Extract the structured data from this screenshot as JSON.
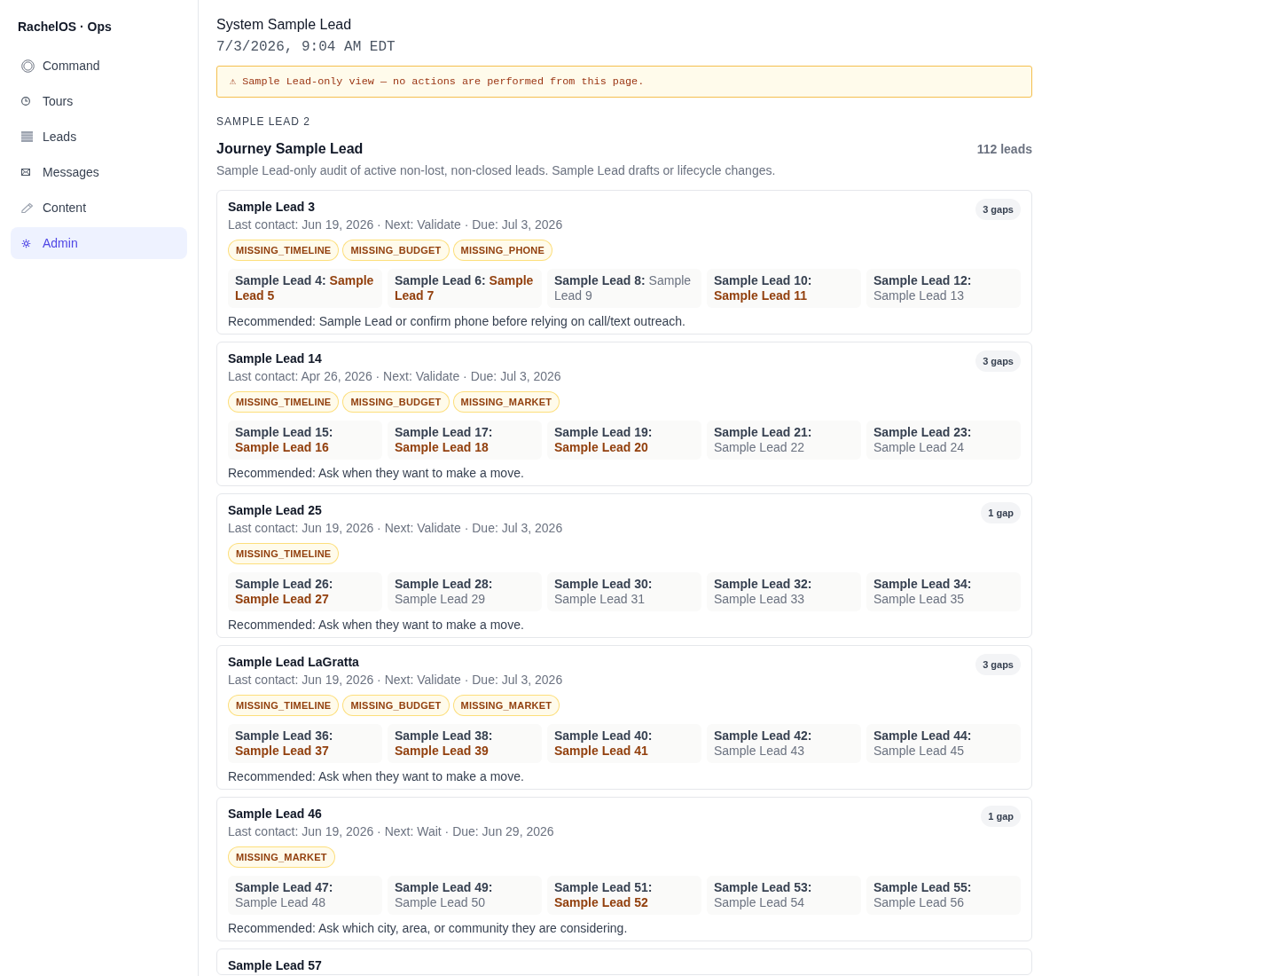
{
  "sidebar": {
    "brand": "RachelOS · Ops",
    "items": [
      {
        "label": "Command",
        "selected": false
      },
      {
        "label": "Tours",
        "selected": false
      },
      {
        "label": "Leads",
        "selected": false
      },
      {
        "label": "Messages",
        "selected": false
      },
      {
        "label": "Content",
        "selected": false
      },
      {
        "label": "Admin",
        "selected": true
      }
    ]
  },
  "header": {
    "title": "System Sample Lead",
    "timestamp": "7/3/2026, 9:04 AM EDT"
  },
  "notice": "⚠ Sample Lead-only view — no actions are performed from this page.",
  "section": {
    "eyebrow": "SAMPLE LEAD 2",
    "title": "Journey Sample Lead",
    "count": "112 leads",
    "description": "Sample Lead-only audit of active non-lost, non-closed leads. Sample Lead drafts or lifecycle changes."
  },
  "leads": [
    {
      "name": "Sample Lead 3",
      "badge": "3 gaps",
      "meta": "Last contact: Jun 19, 2026 · Next: Validate · Due: Jul 3, 2026",
      "tags": [
        "MISSING_TIMELINE",
        "MISSING_BUDGET",
        "MISSING_PHONE"
      ],
      "fields": [
        {
          "label": "Sample Lead 4:",
          "value": "Sample Lead 5",
          "flagged": true
        },
        {
          "label": "Sample Lead 6:",
          "value": "Sample Lead 7",
          "flagged": true
        },
        {
          "label": "Sample Lead 8:",
          "value": "Sample Lead 9",
          "flagged": false
        },
        {
          "label": "Sample Lead 10:",
          "value": "Sample Lead 11",
          "flagged": true
        },
        {
          "label": "Sample Lead 12:",
          "value": "Sample Lead 13",
          "flagged": false
        }
      ],
      "recommendation": "Recommended: Sample Lead or confirm phone before relying on call/text outreach."
    },
    {
      "name": "Sample Lead 14",
      "badge": "3 gaps",
      "meta": "Last contact: Apr 26, 2026 · Next: Validate · Due: Jul 3, 2026",
      "tags": [
        "MISSING_TIMELINE",
        "MISSING_BUDGET",
        "MISSING_MARKET"
      ],
      "fields": [
        {
          "label": "Sample Lead 15:",
          "value": "Sample Lead 16",
          "flagged": true
        },
        {
          "label": "Sample Lead 17:",
          "value": "Sample Lead 18",
          "flagged": true
        },
        {
          "label": "Sample Lead 19:",
          "value": "Sample Lead 20",
          "flagged": true
        },
        {
          "label": "Sample Lead 21:",
          "value": "Sample Lead 22",
          "flagged": false
        },
        {
          "label": "Sample Lead 23:",
          "value": "Sample Lead 24",
          "flagged": false
        }
      ],
      "recommendation": "Recommended: Ask when they want to make a move."
    },
    {
      "name": "Sample Lead 25",
      "badge": "1 gap",
      "meta": "Last contact: Jun 19, 2026 · Next: Validate · Due: Jul 3, 2026",
      "tags": [
        "MISSING_TIMELINE"
      ],
      "fields": [
        {
          "label": "Sample Lead 26:",
          "value": "Sample Lead 27",
          "flagged": true
        },
        {
          "label": "Sample Lead 28:",
          "value": "Sample Lead 29",
          "flagged": false
        },
        {
          "label": "Sample Lead 30:",
          "value": "Sample Lead 31",
          "flagged": false
        },
        {
          "label": "Sample Lead 32:",
          "value": "Sample Lead 33",
          "flagged": false
        },
        {
          "label": "Sample Lead 34:",
          "value": "Sample Lead 35",
          "flagged": false
        }
      ],
      "recommendation": "Recommended: Ask when they want to make a move."
    },
    {
      "name": "Sample Lead LaGratta",
      "badge": "3 gaps",
      "meta": "Last contact: Jun 19, 2026 · Next: Validate · Due: Jul 3, 2026",
      "tags": [
        "MISSING_TIMELINE",
        "MISSING_BUDGET",
        "MISSING_MARKET"
      ],
      "fields": [
        {
          "label": "Sample Lead 36:",
          "value": "Sample Lead 37",
          "flagged": true
        },
        {
          "label": "Sample Lead 38:",
          "value": "Sample Lead 39",
          "flagged": true
        },
        {
          "label": "Sample Lead 40:",
          "value": "Sample Lead 41",
          "flagged": true
        },
        {
          "label": "Sample Lead 42:",
          "value": "Sample Lead 43",
          "flagged": false
        },
        {
          "label": "Sample Lead 44:",
          "value": "Sample Lead 45",
          "flagged": false
        }
      ],
      "recommendation": "Recommended: Ask when they want to make a move."
    },
    {
      "name": "Sample Lead 46",
      "badge": "1 gap",
      "meta": "Last contact: Jun 19, 2026 · Next: Wait · Due: Jun 29, 2026",
      "tags": [
        "MISSING_MARKET"
      ],
      "fields": [
        {
          "label": "Sample Lead 47:",
          "value": "Sample Lead 48",
          "flagged": false
        },
        {
          "label": "Sample Lead 49:",
          "value": "Sample Lead 50",
          "flagged": false
        },
        {
          "label": "Sample Lead 51:",
          "value": "Sample Lead 52",
          "flagged": true
        },
        {
          "label": "Sample Lead 53:",
          "value": "Sample Lead 54",
          "flagged": false
        },
        {
          "label": "Sample Lead 55:",
          "value": "Sample Lead 56",
          "flagged": false
        }
      ],
      "recommendation": "Recommended: Ask which city, area, or community they are considering."
    },
    {
      "name": "Sample Lead 57"
    }
  ]
}
